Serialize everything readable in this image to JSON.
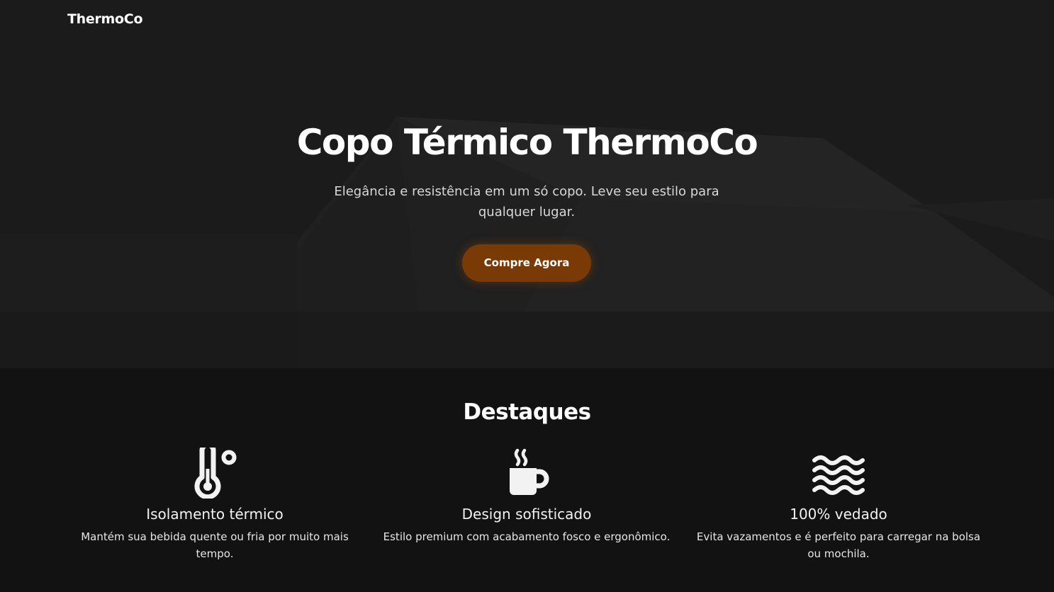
{
  "brand": "ThermoCo",
  "hero": {
    "title": "Copo Térmico ThermoCo",
    "subtitle": "Elegância e resistência em um só copo. Leve seu estilo para qualquer lugar.",
    "cta_label": "Compre Agora"
  },
  "highlights": {
    "title": "Destaques",
    "items": [
      {
        "icon": "thermometer-icon",
        "title": "Isolamento térmico",
        "description": "Mantém sua bebida quente ou fria por muito mais tempo."
      },
      {
        "icon": "hot-mug-icon",
        "title": "Design sofisticado",
        "description": "Estilo premium com acabamento fosco e ergonômico."
      },
      {
        "icon": "water-waves-icon",
        "title": "100% vedado",
        "description": "Evita vazamentos e é perfeito para carregar na bolsa ou mochila."
      }
    ]
  },
  "colors": {
    "background": "#121212",
    "accent": "#7a3a05",
    "text": "#ffffff"
  }
}
